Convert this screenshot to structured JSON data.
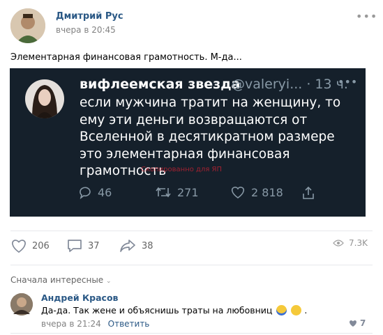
{
  "post": {
    "author": "Дмитрий Рус",
    "date": "вчера в 20:45",
    "menu_icon": "ellipsis-icon",
    "text": "Элементарная финансовая грамотность. М-да..."
  },
  "tweet": {
    "name": "вифлеемская звезда",
    "handle": "@valeryi... · 13 ч.",
    "body_lines": [
      "если мужчина тратит на женщину, то",
      "ему эти деньги возвращаются  от",
      "Вселенной в десятикратном размере",
      "это элементарная финансовая",
      "грамотность"
    ],
    "watermark": "Скопированно для ЯП",
    "replies": "46",
    "retweets": "271",
    "likes": "2 818"
  },
  "actions": {
    "likes": "206",
    "comments": "37",
    "shares": "38",
    "views": "7.3K"
  },
  "comments": {
    "sort_label": "Сначала интересные",
    "items": [
      {
        "author": "Андрей Красов",
        "text": "Да-да. Так жене и объяснишь траты на любовниц",
        "time": "вчера в 21:24",
        "reply": "Ответить",
        "likes": "7"
      }
    ]
  }
}
